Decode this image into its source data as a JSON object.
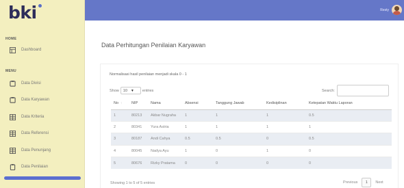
{
  "brand": {
    "logo": "bki"
  },
  "sidebar": {
    "sections": [
      {
        "label": "HOME"
      },
      {
        "label": "MENU"
      }
    ],
    "items": [
      {
        "label": "Dashboard",
        "icon": "dashboard-icon"
      },
      {
        "label": "Data Divisi",
        "icon": "folder-icon"
      },
      {
        "label": "Data Karyawan",
        "icon": "folder-icon"
      },
      {
        "label": "Data Kriteria",
        "icon": "table-icon"
      },
      {
        "label": "Data Referensi",
        "icon": "table-icon"
      },
      {
        "label": "Data Penunjang",
        "icon": "table-icon"
      },
      {
        "label": "Data Penilaian",
        "icon": "clipboard-icon"
      }
    ]
  },
  "topbar": {
    "user_name": "Resty"
  },
  "main": {
    "title": "Data Perhitungan Penilaian Karyawan",
    "note": "Normalisasi hasil penilaian menjadi skala 0 - 1",
    "show_prefix": "Show",
    "show_value": "10",
    "show_suffix": "entries",
    "search_label": "Search:",
    "search_value": "",
    "columns": [
      "No",
      "NIP",
      "Nama",
      "Absensi",
      "Tanggung Jawab",
      "Kedisiplinan",
      "Ketepatan Waktu Laporan"
    ],
    "rows": [
      [
        "1",
        "80213",
        "Akbar Nugraha",
        "1",
        "1",
        "1",
        "0.5"
      ],
      [
        "2",
        "80341",
        "Yura Astria",
        "1",
        "1",
        "1",
        "1"
      ],
      [
        "3",
        "80187",
        "Andi Cahya",
        "0.5",
        "0.5",
        "0",
        "0.5"
      ],
      [
        "4",
        "80045",
        "Nadya Ayu",
        "1",
        "0",
        "1",
        "0"
      ],
      [
        "5",
        "80676",
        "Rizky Pratama",
        "0",
        "0",
        "0",
        "0"
      ]
    ],
    "footer_info": "Showing 1 to 5 of 5 entries",
    "pager": {
      "previous": "Previous",
      "current": "1",
      "next": "Next"
    }
  },
  "colors": {
    "sidebar_bg": "#f3efbf",
    "topbar_bg": "#6577c8",
    "active_bar": "#5b6fd0",
    "striped_row": "#e9edf3"
  }
}
